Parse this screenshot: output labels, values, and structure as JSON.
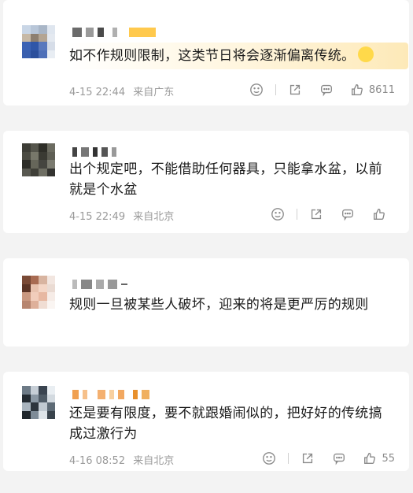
{
  "comments": [
    {
      "text": "如不作规则限制，这类节日将会逐渐偏离传统。",
      "date": "4-15 22:44",
      "location": "来自广东",
      "likes": "8611"
    },
    {
      "text": "出个规定吧，不能借助任何器具，只能拿水盆，以前就是个水盆",
      "date": "4-15 22:49",
      "location": "来自北京",
      "likes": ""
    },
    {
      "text": "规则一旦被某些人破坏，迎来的将是更严厉的规则",
      "date": "",
      "location": "",
      "likes": ""
    },
    {
      "text": "还是要有限度，要不就跟婚闹似的，把好好的传统搞成过激行为",
      "date": "4-16 08:52",
      "location": "来自北京",
      "likes": "55"
    }
  ],
  "icons": {
    "emoji": "smiley-face-icon",
    "share": "share-icon",
    "reply": "comment-bubble-icon",
    "like": "thumbs-up-icon",
    "badge": "sticker-badge-icon"
  },
  "colors": {
    "background": "#f3f3f3",
    "card": "#ffffff",
    "text": "#1a1a1a",
    "meta": "#9a9a9a",
    "highlight": "#fde9b8"
  }
}
